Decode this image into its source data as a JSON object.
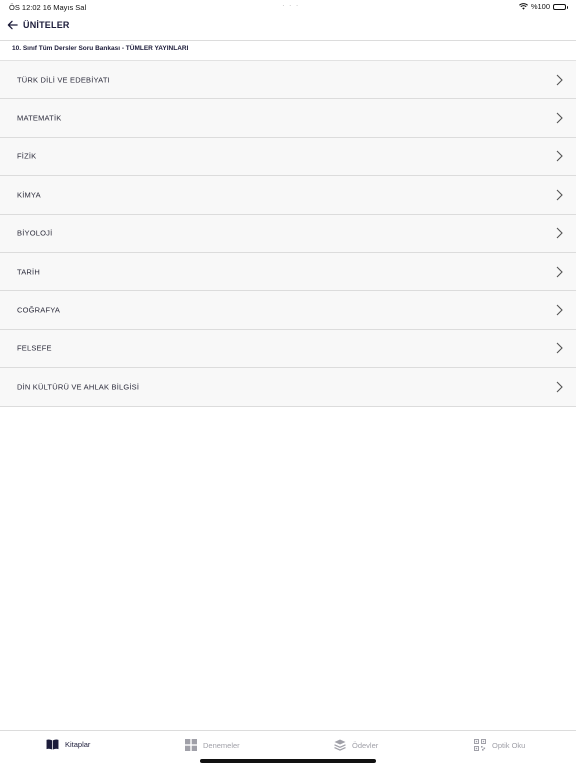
{
  "status_bar": {
    "time_date": "ÖS 12:02   16 Mayıs Sal",
    "dots": "· · ·",
    "battery": "%100"
  },
  "nav": {
    "back_icon": "arrow-left-icon",
    "title": "ÜNİTELER"
  },
  "book_title": "10. Sınıf Tüm Dersler Soru Bankası - TÜMLER YAYINLARI",
  "subjects": [
    {
      "label": "TÜRK DİLİ VE EDEBİYATI"
    },
    {
      "label": "MATEMATİK"
    },
    {
      "label": "FİZİK"
    },
    {
      "label": "KİMYA"
    },
    {
      "label": "BİYOLOJİ"
    },
    {
      "label": "TARİH"
    },
    {
      "label": "COĞRAFYA"
    },
    {
      "label": "FELSEFE"
    },
    {
      "label": "DİN KÜLTÜRÜ VE AHLAK BİLGİSİ"
    }
  ],
  "tabs": [
    {
      "label": "Kitaplar",
      "icon": "book-icon",
      "active": true
    },
    {
      "label": "Denemeler",
      "icon": "grid-icon",
      "active": false
    },
    {
      "label": "Ödevler",
      "icon": "layers-icon",
      "active": false
    },
    {
      "label": "Optik Oku",
      "icon": "qr-code-icon",
      "active": false
    }
  ],
  "colors": {
    "accent": "#1c1c3a",
    "inactive": "#a0a0a8",
    "row_bg": "#f8f8f8"
  }
}
